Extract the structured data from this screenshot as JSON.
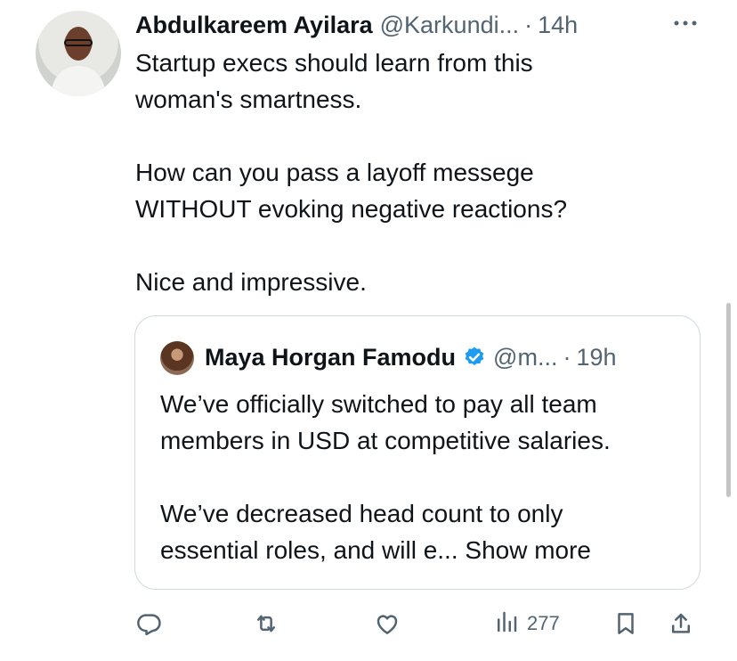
{
  "tweet": {
    "author_name": "Abdulkareem Ayilara",
    "author_handle": "@Karkundi...",
    "separator": "·",
    "time": "14h",
    "more_icon": "more-horizontal-icon",
    "text_lines": [
      "Startup execs should learn from this",
      "woman's smartness.",
      "",
      "How can you pass a layoff messege",
      "WITHOUT evoking negative reactions?",
      "",
      "Nice and impressive."
    ]
  },
  "quote": {
    "author_name": "Maya Horgan Famodu",
    "author_handle": "@m...",
    "separator": "·",
    "time": "19h",
    "verified_color": "#1d9bf0",
    "text_lines": [
      "We’ve officially switched to pay all team",
      "members in USD at competitive salaries.",
      "",
      "We’ve decreased head count to only",
      "essential roles, and will e..."
    ],
    "show_more": "Show more"
  },
  "actions": {
    "reply_icon": "reply-icon",
    "retweet_icon": "retweet-icon",
    "like_icon": "heart-icon",
    "views_icon": "views-chart-icon",
    "views_count": "277",
    "bookmark_icon": "bookmark-icon",
    "share_icon": "share-icon"
  },
  "colors": {
    "text": "#0f1419",
    "secondary": "#536471",
    "border": "#cfd9de",
    "accent": "#1d9bf0"
  }
}
